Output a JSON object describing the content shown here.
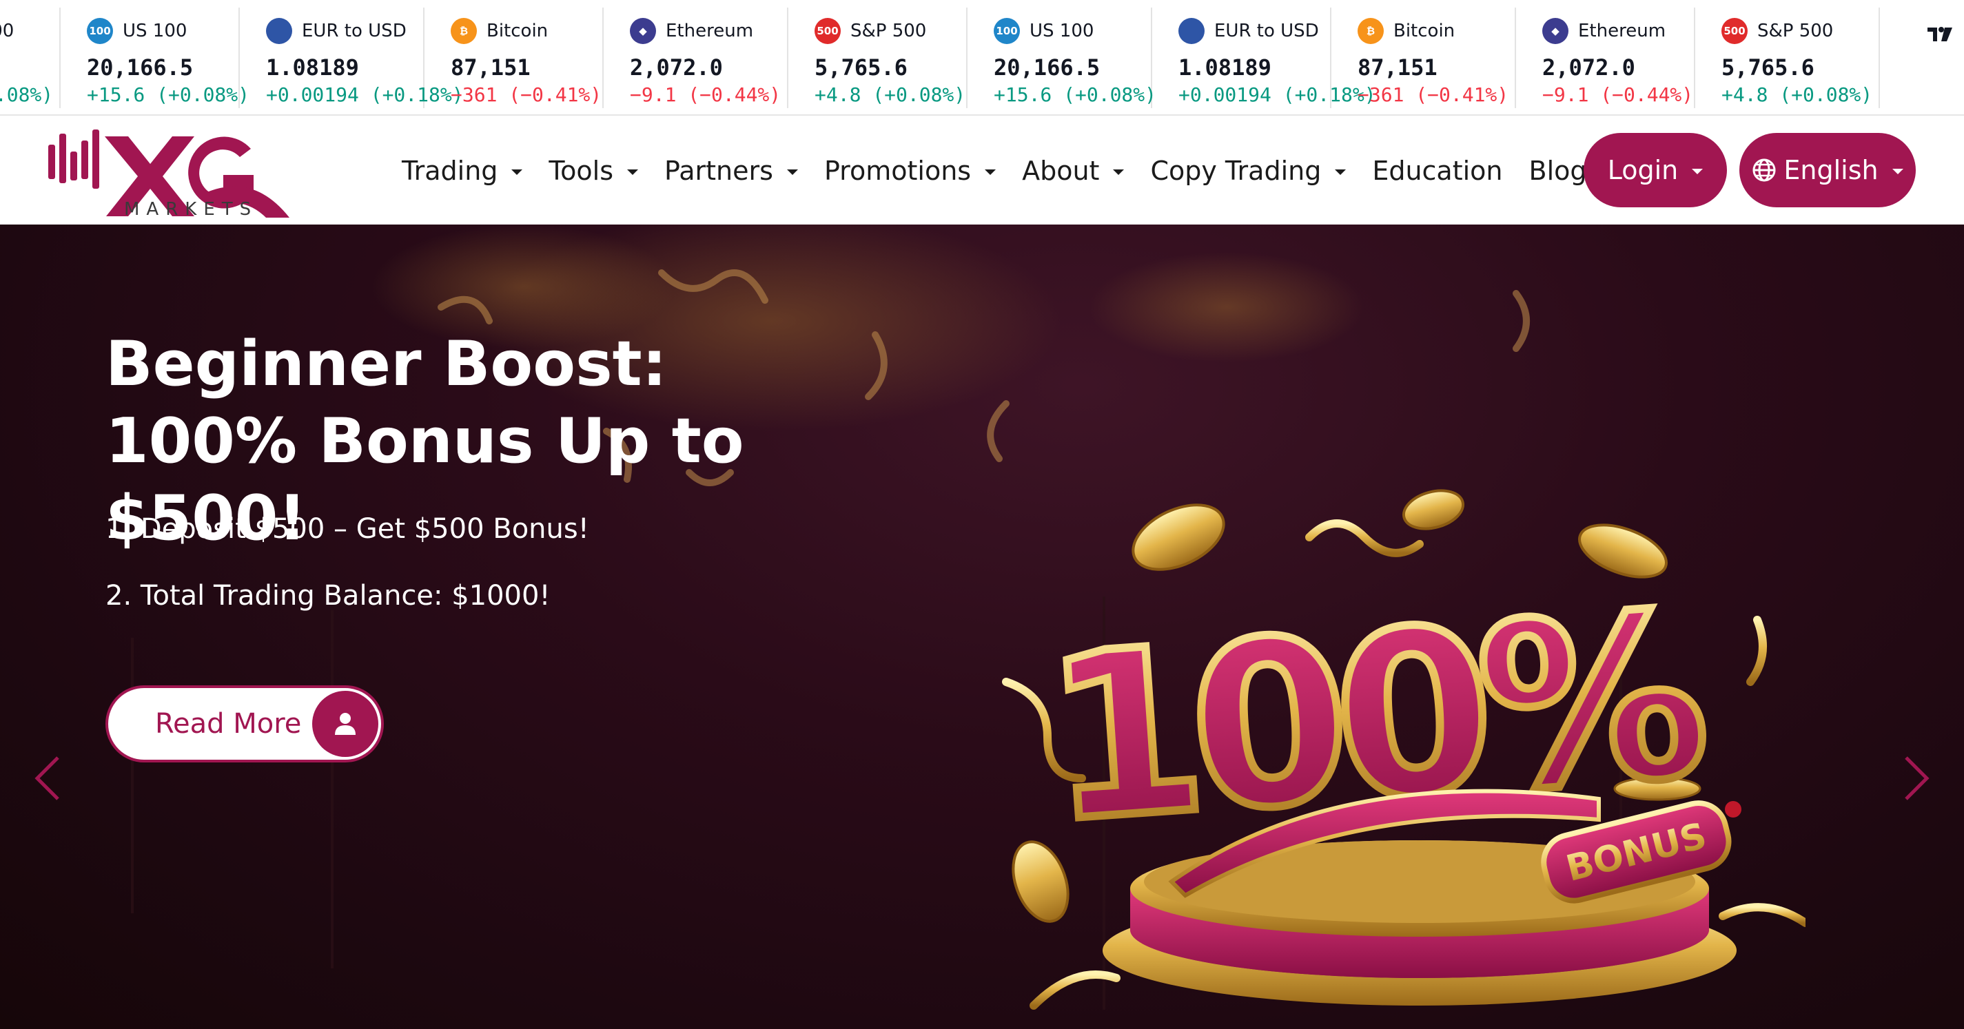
{
  "ticker": {
    "items": [
      {
        "name": "S&P 500",
        "price": "5,765.6",
        "change": "+4.8 (+0.08%)",
        "direction": "up",
        "icon": "sp500-icon",
        "badge": "500",
        "color": "#e02b2b"
      },
      {
        "name": "US 100",
        "price": "20,166.5",
        "change": "+15.6 (+0.08%)",
        "direction": "up",
        "icon": "us100-icon",
        "badge": "100",
        "color": "#1f86c9"
      },
      {
        "name": "EUR to USD",
        "price": "1.08189",
        "change": "+0.00194 (+0.18%)",
        "direction": "up",
        "icon": "eur-usd-flag-icon",
        "badge": "",
        "color": "#2e55a6"
      },
      {
        "name": "Bitcoin",
        "price": "87,151",
        "change": "−361 (−0.41%)",
        "direction": "down",
        "icon": "bitcoin-icon",
        "badge": "₿",
        "color": "#f7931a"
      },
      {
        "name": "Ethereum",
        "price": "2,072.0",
        "change": "−9.1 (−0.44%)",
        "direction": "down",
        "icon": "ethereum-icon",
        "badge": "◆",
        "color": "#3c3c8f"
      },
      {
        "name": "S&P 500",
        "price": "5,765.6",
        "change": "+4.8 (+0.08%)",
        "direction": "up",
        "icon": "sp500-icon",
        "badge": "500",
        "color": "#e02b2b"
      },
      {
        "name": "US 100",
        "price": "20,166.5",
        "change": "+15.6 (+0.08%)",
        "direction": "up",
        "icon": "us100-icon",
        "badge": "100",
        "color": "#1f86c9"
      },
      {
        "name": "EUR to USD",
        "price": "1.08189",
        "change": "+0.00194 (+0.18%)",
        "direction": "up",
        "icon": "eur-usd-flag-icon",
        "badge": "",
        "color": "#2e55a6"
      },
      {
        "name": "Bitcoin",
        "price": "87,151",
        "change": "−361 (−0.41%)",
        "direction": "down",
        "icon": "bitcoin-icon",
        "badge": "₿",
        "color": "#f7931a"
      },
      {
        "name": "Ethereum",
        "price": "2,072.0",
        "change": "−9.1 (−0.44%)",
        "direction": "down",
        "icon": "ethereum-icon",
        "badge": "◆",
        "color": "#3c3c8f"
      },
      {
        "name": "S&P 500",
        "price": "5,765.6",
        "change": "+4.8 (+0.08%)",
        "direction": "up",
        "icon": "sp500-icon",
        "badge": "500",
        "color": "#e02b2b"
      }
    ],
    "widget_icon": "tradingview-icon"
  },
  "brand": {
    "logo_text": "XG",
    "logo_subtext": "MARKETS",
    "accent": "#a11651"
  },
  "nav": {
    "items": [
      {
        "label": "Trading",
        "dropdown": true
      },
      {
        "label": "Tools",
        "dropdown": true
      },
      {
        "label": "Partners",
        "dropdown": true
      },
      {
        "label": "Promotions",
        "dropdown": true
      },
      {
        "label": "About",
        "dropdown": true
      },
      {
        "label": "Copy Trading",
        "dropdown": true
      },
      {
        "label": "Education",
        "dropdown": false
      },
      {
        "label": "Blog",
        "dropdown": false
      }
    ],
    "login_label": "Login",
    "language_label": "English"
  },
  "hero": {
    "title": "Beginner Boost: 100% Bonus Up to $500!",
    "line1": "1. Deposit $500 – Get $500 Bonus!",
    "line2": "2. Total Trading Balance: $1000!",
    "read_more_label": "Read More",
    "promo_big_text": "100%",
    "promo_badge_text": "BONUS"
  }
}
